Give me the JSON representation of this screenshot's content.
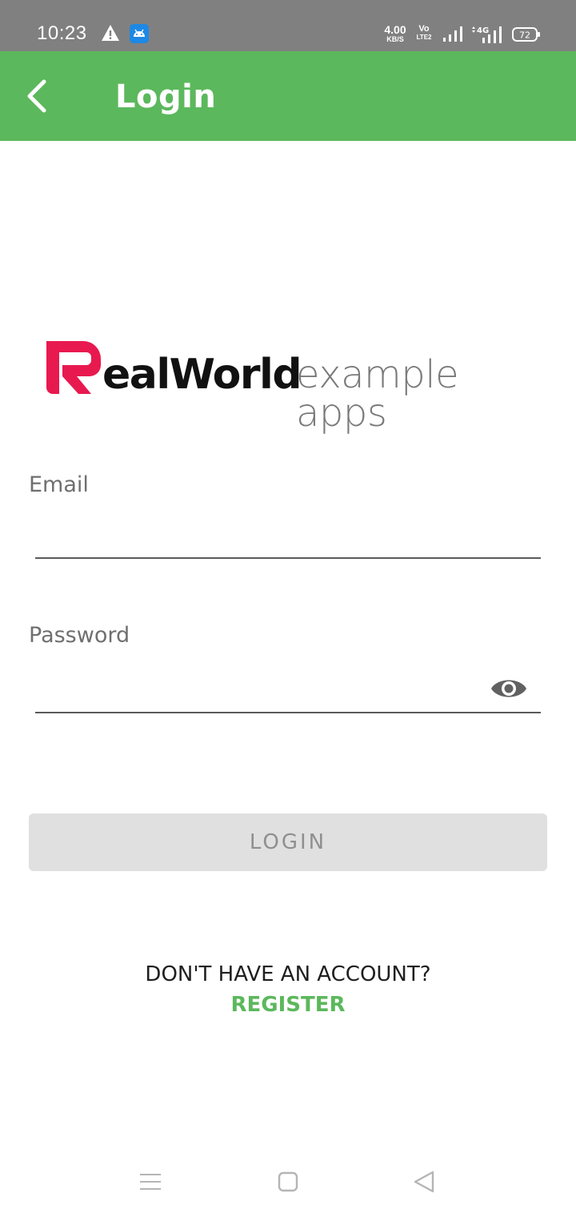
{
  "status_bar": {
    "time": "10:23",
    "net_speed_value": "4.00",
    "net_speed_unit": "KB/S",
    "volte_top": "Vo",
    "volte_bottom": "LTE2",
    "network_type": "4G",
    "battery_level": "72",
    "icons": [
      "warning-icon",
      "android-notification-icon",
      "signal-icon",
      "4g-signal-icon",
      "battery-icon"
    ]
  },
  "app_bar": {
    "title": "Login",
    "back_icon": "chevron-left-icon",
    "background_color": "#5cb85c"
  },
  "logo": {
    "brand_bold": "ealWorld",
    "brand_light": "example apps",
    "mark_color": "#e8194f"
  },
  "form": {
    "email_label": "Email",
    "email_value": "",
    "password_label": "Password",
    "password_value": "",
    "password_toggle_icon": "eye-icon",
    "login_button_label": "LOGIN"
  },
  "footer": {
    "no_account_text": "DON'T HAVE AN ACCOUNT?",
    "register_label": "REGISTER",
    "accent_color": "#5cb85c"
  },
  "nav_bar": {
    "icons": [
      "menu-icon",
      "home-icon",
      "back-triangle-icon"
    ]
  }
}
